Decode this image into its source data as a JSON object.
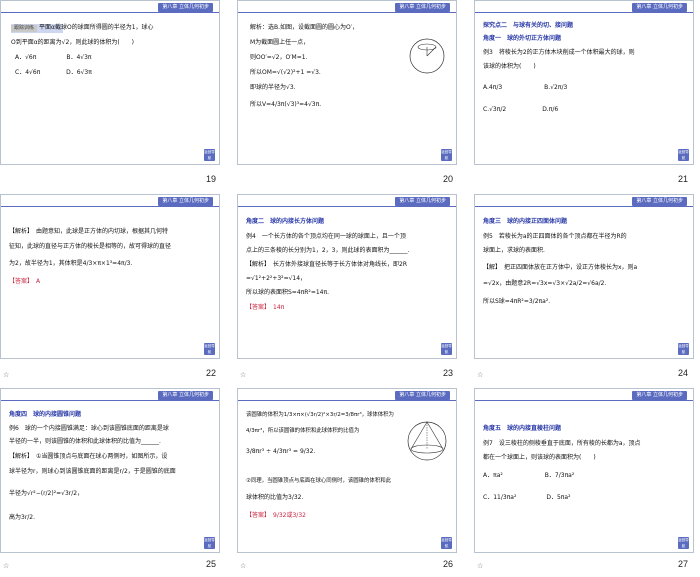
{
  "colors": {
    "accent": "#5b6cc0",
    "answer_red": "#c8243e",
    "heading_blue": "#2a3aa8"
  },
  "header_text": "第八章 立体几何初步",
  "back_button": "返回导航",
  "star_icon": "☆",
  "slides": [
    {
      "num": "19",
      "lines": [
        "平面α截球O的球面所得圆的半径为1，球心",
        "O到平面α的距离为√2，则此球的体积为(　　)",
        "A．√6π　　　　　B．4√3π",
        "C．4√6π　　　　 D．6√3π"
      ]
    },
    {
      "num": "20",
      "lines": [
        "解析：选B.如图，设截面圆的圆心为O′，",
        "M为截面圆上任一点，",
        "则OO′=√2，O′M=1.",
        "所以OM=√(√2)²+1 =√3.",
        "即球的半径为√3.",
        "所以V=4/3π(√3)³=4√3π."
      ]
    },
    {
      "num": "21",
      "lines": [
        "探究点二　与球有关的切、接问题",
        "角度一　球的外切正方体问题",
        "例3　将棱长为2的正方体木块削成一个体积最大的球，则",
        "该球的体积为(　　)",
        "A.4π/3　　　　　　　B.√2π/3",
        "C.√3π/2　　　　　　D.π/6"
      ]
    },
    {
      "num": "22",
      "lines": [
        "【解析】　由题意知，此球是正方体的内切球，根据其几何特",
        "征知，此球的直径与正方体的棱长是相等的，故可得球的直径",
        "为2，故半径为1，其体积是4/3×π×1³=4π/3.",
        "【答案】　A"
      ]
    },
    {
      "num": "23",
      "lines": [
        "角度二　球的内接长方体问题",
        "例4　一个长方体的各个顶点均在同一球的球面上，且一个顶",
        "点上的三条棱的长分别为1，2，3，则此球的表面积为______.",
        "【解析】　长方体外接球直径长等于长方体体对角线长，即2R",
        "=√1²+2²+3²=√14，",
        "所以球的表面积S=4πR²=14π.",
        "【答案】　14π"
      ]
    },
    {
      "num": "24",
      "lines": [
        "角度三　球的内接正四面体问题",
        "例5　若棱长为a的正四面体的各个顶点都在半径为R的",
        "球面上，求球的表面积.",
        "【解】　把正四面体放在正方体中，设正方体棱长为x，则a",
        "=√2x，由题意2R=√3x=√3×√2a/2=√6a/2.",
        "所以S球=4πR²=3/2πa²."
      ]
    },
    {
      "num": "25",
      "lines": [
        "角度四　球的内接圆锥问题",
        "例6　球的一个内接圆锥满足：球心到该圆锥底面的距离是球",
        "半径的一半，则该圆锥的体积和此球体积的比值为______.",
        "【解析】　①当圆锥顶点与底面在球心两侧时，如图所示，设",
        "球半径为r，则球心到该圆锥底面的距离是r/2，于是圆锥的底面",
        "半径为√r²−(r/2)²=√3r/2，",
        "高为3r/2."
      ]
    },
    {
      "num": "26",
      "lines": [
        "该圆锥的体积为1/3×π×(√3r/2)²×3r/2=3/8πr³，球体体积为",
        "4/3πr³，所以该圆锥的体积和此球体积的比值为",
        "3/8πr³ ÷ 4/3πr³ = 9/32.",
        "②同理，当圆锥顶点与底面在球心同侧时，该圆锥的体积和此",
        "球体积的比值为3/32.",
        "【答案】　9/32或3/32"
      ]
    },
    {
      "num": "27",
      "lines": [
        "角度五　球的内接直棱柱问题",
        "例7　设三棱柱的侧棱垂直于底面，所有棱的长都为a，顶点",
        "都在一个球面上，则该球的表面积为(　　)",
        "A．πa²　　　　　　　B．7/3πa²",
        "C．11/3πa²　　　　　D．5πa²"
      ]
    }
  ]
}
